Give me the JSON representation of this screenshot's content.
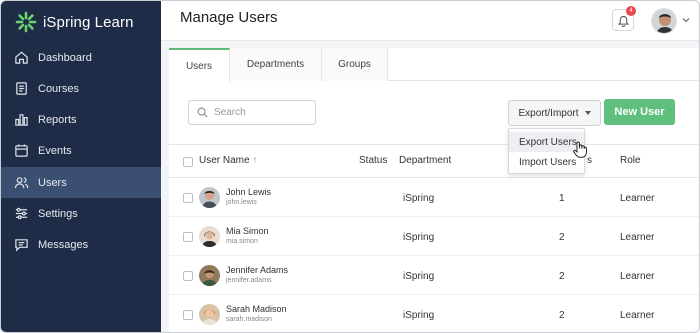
{
  "app": {
    "brand": "iSpring Learn",
    "accent": "#5fbf7c",
    "sidebar_bg": "#1f2c47"
  },
  "sidebar": {
    "items": [
      {
        "label": "Dashboard",
        "icon": "home-icon"
      },
      {
        "label": "Courses",
        "icon": "book-icon"
      },
      {
        "label": "Reports",
        "icon": "bar-chart-icon"
      },
      {
        "label": "Events",
        "icon": "calendar-icon"
      },
      {
        "label": "Users",
        "icon": "users-icon",
        "active": true
      },
      {
        "label": "Settings",
        "icon": "sliders-icon"
      },
      {
        "label": "Messages",
        "icon": "message-icon"
      }
    ]
  },
  "header": {
    "title": "Manage Users",
    "notifications": "4"
  },
  "tabs": [
    {
      "label": "Users",
      "active": true
    },
    {
      "label": "Departments"
    },
    {
      "label": "Groups"
    }
  ],
  "toolbar": {
    "search_placeholder": "Search",
    "export_label": "Export/Import",
    "new_user_label": "New User",
    "export_menu": [
      "Export Users",
      "Import Users"
    ]
  },
  "table": {
    "columns": {
      "name": "User Name",
      "status": "Status",
      "department": "Department",
      "courses_suffix": "s",
      "role": "Role"
    },
    "rows": [
      {
        "name": "John Lewis",
        "login": "john.lewis",
        "department": "iSpring",
        "courses": "1",
        "role": "Learner"
      },
      {
        "name": "Mia Simon",
        "login": "mia.simon",
        "department": "iSpring",
        "courses": "2",
        "role": "Learner"
      },
      {
        "name": "Jennifer Adams",
        "login": "jennifer.adams",
        "department": "iSpring",
        "courses": "2",
        "role": "Learner"
      },
      {
        "name": "Sarah Madison",
        "login": "sarah.madison",
        "department": "iSpring",
        "courses": "2",
        "role": "Learner"
      }
    ]
  }
}
